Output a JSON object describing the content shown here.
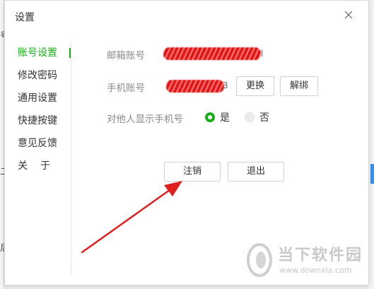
{
  "background": {
    "glyph_top": "号",
    "glyph_mid": "二",
    "glyph_bottom": "后"
  },
  "dialog": {
    "title": "设置",
    "close_icon": "close-icon"
  },
  "sidebar": {
    "items": [
      {
        "label": "账号设置",
        "active": true
      },
      {
        "label": "修改密码",
        "active": false
      },
      {
        "label": "通用设置",
        "active": false
      },
      {
        "label": "快捷按键",
        "active": false
      },
      {
        "label": "意见反馈",
        "active": false
      },
      {
        "label": "关于",
        "active": false
      }
    ]
  },
  "account": {
    "email_label": "邮箱账号",
    "email_value_tail": "l",
    "phone_label": "手机账号",
    "phone_value_tail": "3",
    "change_button": "更换",
    "unbind_button": "解绑",
    "show_phone_label": "对他人显示手机号",
    "show_phone_yes": "是",
    "show_phone_no": "否",
    "show_phone_selected": "是",
    "logout_account_button": "注销",
    "exit_button": "退出"
  },
  "colors": {
    "accent": "#1aad19",
    "annotation_arrow": "#e02020"
  },
  "watermark": {
    "name": "当下软件园",
    "url": "www.downxia.com"
  }
}
